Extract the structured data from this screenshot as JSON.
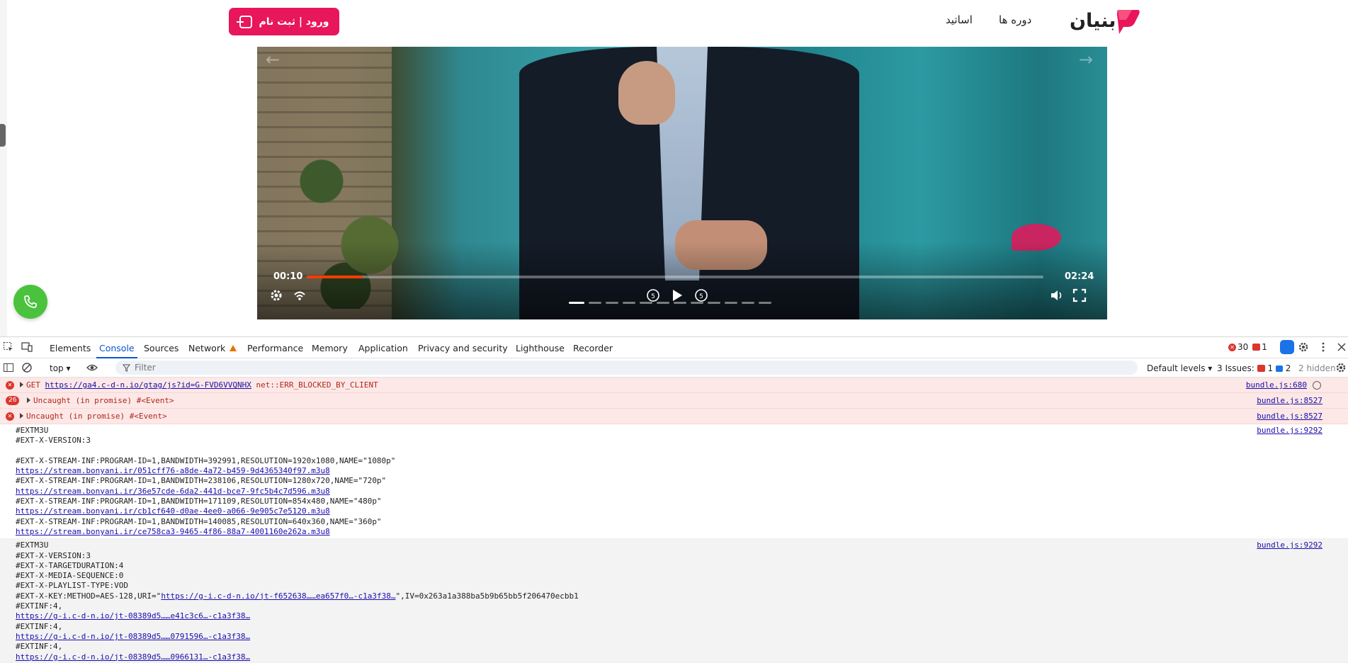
{
  "site": {
    "logo_text": "بنیان",
    "nav": {
      "courses": "دوره ها",
      "teachers": "اساتید"
    },
    "login_label": "ورود | ثبت نام",
    "video": {
      "current_time": "00:10",
      "duration": "02:24",
      "progress_fraction": 0.076
    }
  },
  "devtools": {
    "tabs": [
      "Elements",
      "Console",
      "Sources",
      "Network",
      "Performance",
      "Memory",
      "Application",
      "Privacy and security",
      "Lighthouse",
      "Recorder"
    ],
    "active_tab": "Console",
    "error_count": "30",
    "warning_count": "1",
    "context": "top",
    "filter_placeholder": "Filter",
    "levels": "Default levels",
    "issues_label": "3 Issues:",
    "issues_err": "1",
    "issues_info": "2",
    "hidden_label": "2 hidden",
    "messages": [
      {
        "type": "error",
        "badge": "x",
        "text_prefix": "GET ",
        "link": "https://ga4.c-d-n.io/gtag/js?id=G-FVD6VVQNHX",
        "text_suffix": " net::ERR_BLOCKED_BY_CLIENT",
        "source": "bundle.js:680"
      },
      {
        "type": "error",
        "badge": "26",
        "text": "Uncaught (in promise) #<Event>",
        "source": "bundle.js:8527"
      },
      {
        "type": "error",
        "badge": "x",
        "text": "Uncaught (in promise) #<Event>",
        "source": "bundle.js:8527"
      }
    ],
    "log1": {
      "source": "bundle.js:9292",
      "lines": [
        "#EXTM3U",
        "#EXT-X-VERSION:3",
        "",
        "#EXT-X-STREAM-INF:PROGRAM-ID=1,BANDWIDTH=392991,RESOLUTION=1920x1080,NAME=\"1080p\"",
        "@https://stream.bonyani.ir/051cff76-a8de-4a72-b459-9d4365340f97.m3u8",
        "#EXT-X-STREAM-INF:PROGRAM-ID=1,BANDWIDTH=238106,RESOLUTION=1280x720,NAME=\"720p\"",
        "@https://stream.bonyani.ir/36e57cde-6da2-441d-bce7-9fc5b4c7d596.m3u8",
        "#EXT-X-STREAM-INF:PROGRAM-ID=1,BANDWIDTH=171109,RESOLUTION=854x480,NAME=\"480p\"",
        "@https://stream.bonyani.ir/cb1cf640-d0ae-4ee0-a066-9e905c7e5120.m3u8",
        "#EXT-X-STREAM-INF:PROGRAM-ID=1,BANDWIDTH=140085,RESOLUTION=640x360,NAME=\"360p\"",
        "@https://stream.bonyani.ir/ce758ca3-9465-4f86-88a7-4001160e262a.m3u8"
      ]
    },
    "log2": {
      "source": "bundle.js:9292",
      "lines": [
        "#EXTM3U",
        "#EXT-X-VERSION:3",
        "#EXT-X-TARGETDURATION:4",
        "#EXT-X-MEDIA-SEQUENCE:0",
        "#EXT-X-PLAYLIST-TYPE:VOD"
      ],
      "key_prefix": "#EXT-X-KEY:METHOD=AES-128,URI=\"",
      "key_link": "https://g-i.c-d-n.io/jt-f652638……ea657f0…-c1a3f38…",
      "key_suffix": "\",IV=0x263a1a388ba5b9b65bb5f206470ecbb1",
      "segments": [
        {
          "inf": "#EXTINF:4,",
          "link": "https://g-i.c-d-n.io/jt-08389d5……e41c3c6…-c1a3f38…"
        },
        {
          "inf": "#EXTINF:4,",
          "link": "https://g-i.c-d-n.io/jt-08389d5……0791596…-c1a3f38…"
        },
        {
          "inf": "#EXTINF:4,",
          "link": "https://g-i.c-d-n.io/jt-08389d5……0966131…-c1a3f38…"
        }
      ]
    }
  }
}
